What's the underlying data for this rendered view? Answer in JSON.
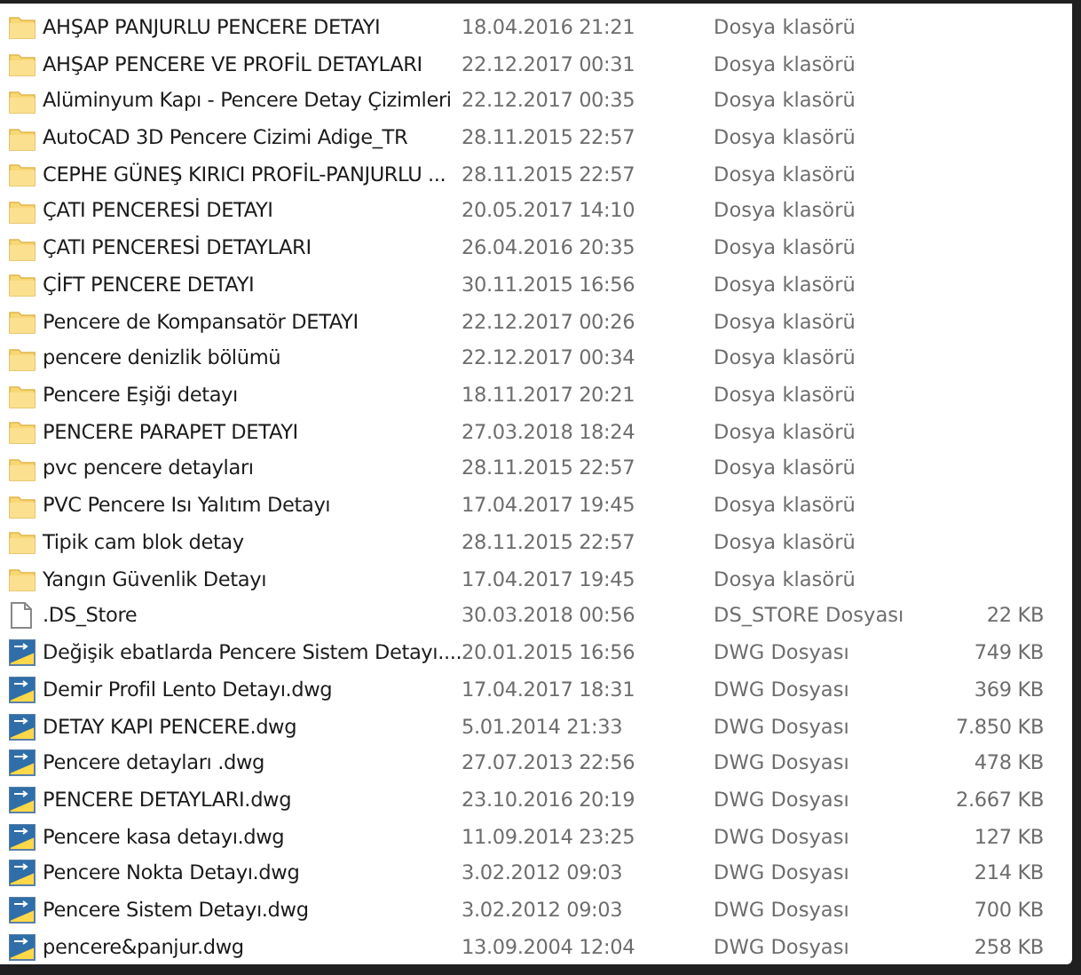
{
  "files": [
    {
      "kind": "folder",
      "name": "AHŞAP PANJURLU PENCERE DETAYI",
      "date": "18.04.2016 21:21",
      "type": "Dosya klasörü"
    },
    {
      "kind": "folder",
      "name": "AHŞAP PENCERE VE PROFİL DETAYLARI",
      "date": "22.12.2017 00:31",
      "type": "Dosya klasörü"
    },
    {
      "kind": "folder",
      "name": "Alüminyum Kapı - Pencere Detay Çizimleri",
      "date": "22.12.2017 00:35",
      "type": "Dosya klasörü"
    },
    {
      "kind": "folder",
      "name": "AutoCAD 3D Pencere Cizimi Adige_TR",
      "date": "28.11.2015 22:57",
      "type": "Dosya klasörü"
    },
    {
      "kind": "folder",
      "name": "CEPHE GÜNEŞ KIRICI PROFİL-PANJURLU ...",
      "date": "28.11.2015 22:57",
      "type": "Dosya klasörü"
    },
    {
      "kind": "folder",
      "name": "ÇATI PENCERESİ DETAYI",
      "date": "20.05.2017 14:10",
      "type": "Dosya klasörü"
    },
    {
      "kind": "folder",
      "name": "ÇATI PENCERESİ DETAYLARI",
      "date": "26.04.2016 20:35",
      "type": "Dosya klasörü"
    },
    {
      "kind": "folder",
      "name": "ÇİFT PENCERE DETAYI",
      "date": "30.11.2015 16:56",
      "type": "Dosya klasörü"
    },
    {
      "kind": "folder",
      "name": "Pencere de Kompansatör DETAYI",
      "date": "22.12.2017 00:26",
      "type": "Dosya klasörü"
    },
    {
      "kind": "folder",
      "name": "pencere denizlik bölümü",
      "date": "22.12.2017 00:34",
      "type": "Dosya klasörü"
    },
    {
      "kind": "folder",
      "name": "Pencere Eşiği detayı",
      "date": "18.11.2017 20:21",
      "type": "Dosya klasörü"
    },
    {
      "kind": "folder",
      "name": "PENCERE PARAPET DETAYI",
      "date": "27.03.2018 18:24",
      "type": "Dosya klasörü"
    },
    {
      "kind": "folder",
      "name": "pvc pencere detayları",
      "date": "28.11.2015 22:57",
      "type": "Dosya klasörü"
    },
    {
      "kind": "folder",
      "name": "PVC Pencere Isı Yalıtım Detayı",
      "date": "17.04.2017 19:45",
      "type": "Dosya klasörü"
    },
    {
      "kind": "folder",
      "name": "Tipik cam blok detay",
      "date": "28.11.2015 22:57",
      "type": "Dosya klasörü"
    },
    {
      "kind": "folder",
      "name": "Yangın Güvenlik Detayı",
      "date": "17.04.2017 19:45",
      "type": "Dosya klasörü"
    },
    {
      "kind": "file",
      "name": ".DS_Store",
      "date": "30.03.2018 00:56",
      "type": "DS_STORE Dosyası",
      "size": "22 KB"
    },
    {
      "kind": "dwg",
      "name": "Değişik ebatlarda Pencere Sistem Detayı....",
      "date": "20.01.2015 16:56",
      "type": "DWG Dosyası",
      "size": "749 KB"
    },
    {
      "kind": "dwg",
      "name": "Demir Profil Lento Detayı.dwg",
      "date": "17.04.2017 18:31",
      "type": "DWG Dosyası",
      "size": "369 KB"
    },
    {
      "kind": "dwg",
      "name": "DETAY KAPI PENCERE.dwg",
      "date": "5.01.2014 21:33",
      "type": "DWG Dosyası",
      "size": "7.850 KB"
    },
    {
      "kind": "dwg",
      "name": "Pencere detayları .dwg",
      "date": "27.07.2013 22:56",
      "type": "DWG Dosyası",
      "size": "478 KB"
    },
    {
      "kind": "dwg",
      "name": "PENCERE DETAYLARI.dwg",
      "date": "23.10.2016 20:19",
      "type": "DWG Dosyası",
      "size": "2.667 KB"
    },
    {
      "kind": "dwg",
      "name": "Pencere kasa detayı.dwg",
      "date": "11.09.2014 23:25",
      "type": "DWG Dosyası",
      "size": "127 KB"
    },
    {
      "kind": "dwg",
      "name": "Pencere Nokta Detayı.dwg",
      "date": "3.02.2012 09:03",
      "type": "DWG Dosyası",
      "size": "214 KB"
    },
    {
      "kind": "dwg",
      "name": "Pencere Sistem Detayı.dwg",
      "date": "3.02.2012 09:03",
      "type": "DWG Dosyası",
      "size": "700 KB"
    },
    {
      "kind": "dwg",
      "name": "pencere&panjur.dwg",
      "date": "13.09.2004 12:04",
      "type": "DWG Dosyası",
      "size": "258 KB"
    }
  ]
}
